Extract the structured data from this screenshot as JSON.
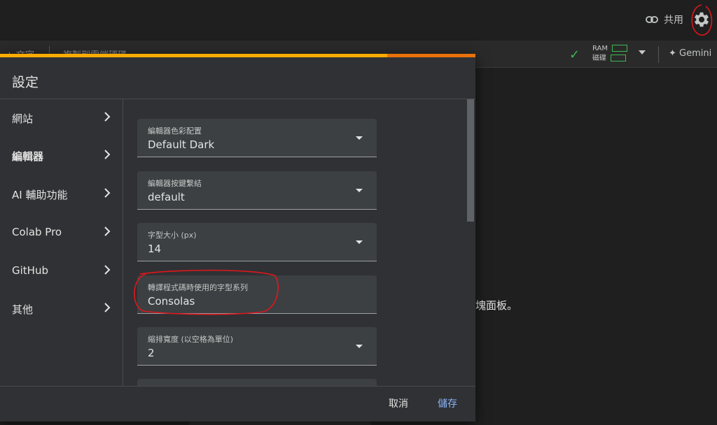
{
  "header": {
    "share_label": "共用",
    "icons": [
      "link-icon",
      "gear-icon"
    ]
  },
  "toolbar": {
    "left_text": "+ 文字",
    "left_text2": "複製到雲端硬碟",
    "ram_label": "RAM",
    "disk_label": "磁碟",
    "gemini_label": "✦ Gemini"
  },
  "background": {
    "partial_text": "塊面板。"
  },
  "dialog": {
    "title": "設定",
    "nav": [
      {
        "label": "網站"
      },
      {
        "label": "編輯器"
      },
      {
        "label": "AI 輔助功能"
      },
      {
        "label": "Colab Pro"
      },
      {
        "label": "GitHub"
      },
      {
        "label": "其他"
      }
    ],
    "active_nav": "編輯器",
    "fields": [
      {
        "label": "編輯器色彩配置",
        "value": "Default Dark",
        "dropdown": true
      },
      {
        "label": "編輯器按鍵繫結",
        "value": "default",
        "dropdown": true
      },
      {
        "label": "字型大小 (px)",
        "value": "14",
        "dropdown": true
      },
      {
        "label": "轉譯程式碼時使用的字型系列",
        "value": "Consolas",
        "dropdown": false
      },
      {
        "label": "縮排寬度 (以空格為單位)",
        "value": "2",
        "dropdown": true
      }
    ],
    "cancel_label": "取消",
    "save_label": "儲存",
    "progress_fraction": 0.815
  },
  "colors": {
    "accent_blue": "#8ab4f8",
    "progress_orange": "#e8710a",
    "progress_yellow": "#f9ab00",
    "annotation_red": "#e0161b",
    "status_green": "#3fb950"
  }
}
